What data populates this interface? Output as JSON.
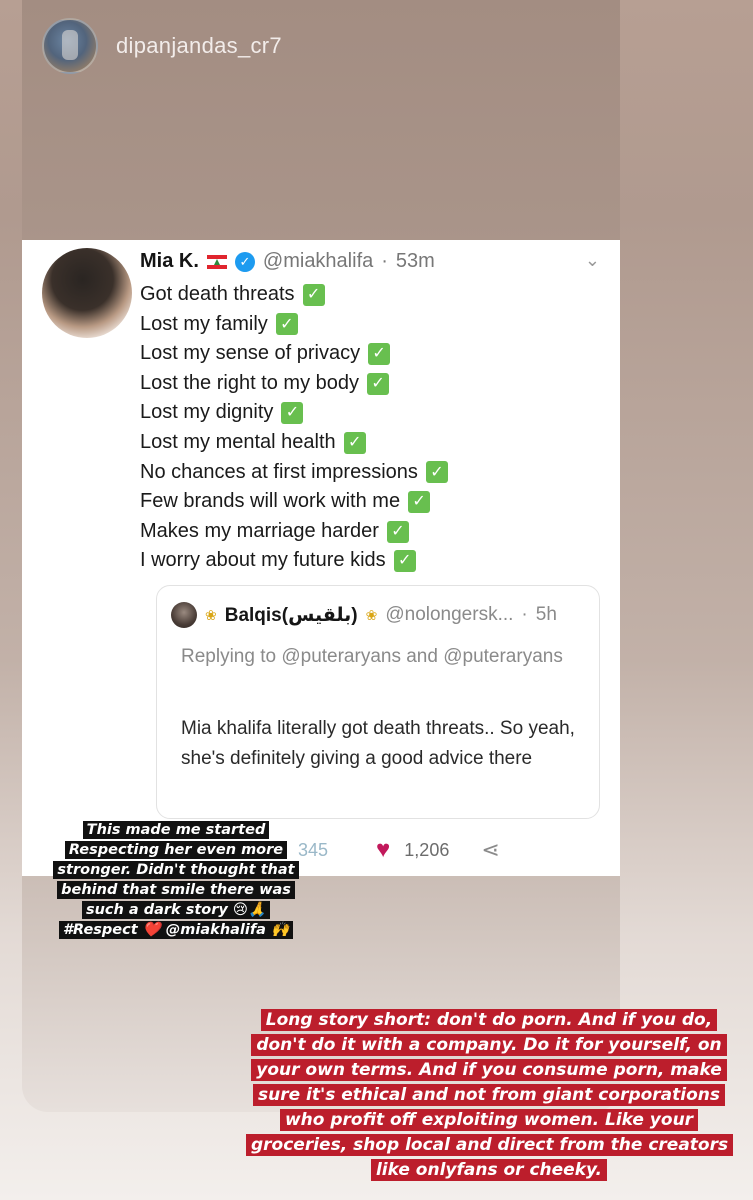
{
  "story": {
    "username": "dipanjandas_cr7"
  },
  "tweet": {
    "author_name": "Mia K.",
    "handle": "@miakhalifa",
    "separator": "·",
    "time": "53m",
    "lines": [
      "Got death threats",
      "Lost my family",
      "Lost my sense of privacy",
      "Lost the right to my body",
      "Lost my dignity",
      "Lost my mental health",
      "No chances at first impressions",
      "Few brands will work with me",
      "Makes my marriage harder",
      "I worry about my future kids"
    ],
    "check_glyph": "✓",
    "quoted": {
      "name": "Balqis(بلقيس)",
      "handle": "@nolongersk...",
      "separator": "·",
      "time": "5h",
      "replying": "Replying to @puteraryans and @puteraryans",
      "text": "Mia khalifa literally got death threats.. So yeah, she's definitely giving a good advice there"
    },
    "stats": {
      "retweets": "345",
      "likes": "1,206"
    }
  },
  "stickers": {
    "left_text": "This made me started Respecting her even more stronger. Didn't thought that behind that smile there was such a dark story 😢🙏 #Respect ❤️ @miakhalifa 🙌",
    "right_text": "Long story short: don't do porn. And if you do, don't do it with a company. Do it for yourself, on your own terms. And if you consume porn, make sure it's ethical and not from giant corporations who profit off exploiting women. Like your groceries, shop local and direct from the creators like onlyfans or cheeky."
  },
  "colors": {
    "check": "#68bf4f",
    "heart": "#c2185b",
    "verified": "#1d9bf0",
    "right_sticker": "#bc1e2c",
    "left_sticker": "#111111"
  }
}
